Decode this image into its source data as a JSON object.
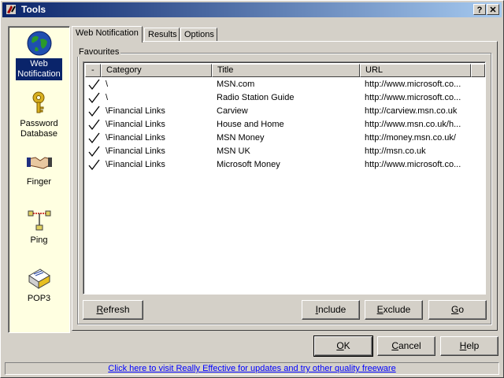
{
  "window": {
    "title": "Tools",
    "help_glyph": "?",
    "close_glyph": "✕"
  },
  "sidebar": {
    "items": [
      {
        "label_line1": "Web",
        "label_line2": "Notification",
        "icon": "globe-icon",
        "selected": true
      },
      {
        "label_line1": "Password",
        "label_line2": "Database",
        "icon": "key-icon"
      },
      {
        "label_line1": "Finger",
        "label_line2": "",
        "icon": "handshake-icon"
      },
      {
        "label_line1": "Ping",
        "label_line2": "",
        "icon": "network-icon"
      },
      {
        "label_line1": "POP3",
        "label_line2": "",
        "icon": "mail-icon"
      }
    ]
  },
  "tabs": [
    {
      "label": "Web Notification",
      "active": true
    },
    {
      "label": "Results"
    },
    {
      "label": "Options"
    }
  ],
  "favourites": {
    "group_label": "Favourites",
    "columns": [
      "-",
      "Category",
      "Title",
      "URL"
    ],
    "rows": [
      {
        "checked": true,
        "category": "\\",
        "title": "MSN.com",
        "url": "http://www.microsoft.co..."
      },
      {
        "checked": true,
        "category": "\\",
        "title": "Radio Station Guide",
        "url": "http://www.microsoft.co..."
      },
      {
        "checked": true,
        "category": "\\Financial Links",
        "title": "Carview",
        "url": "http://carview.msn.co.uk"
      },
      {
        "checked": true,
        "category": "\\Financial Links",
        "title": "House and Home",
        "url": "http://www.msn.co.uk/h..."
      },
      {
        "checked": true,
        "category": "\\Financial Links",
        "title": "MSN Money",
        "url": "http://money.msn.co.uk/"
      },
      {
        "checked": true,
        "category": "\\Financial Links",
        "title": "MSN UK",
        "url": "http://msn.co.uk"
      },
      {
        "checked": true,
        "category": "\\Financial Links",
        "title": "Microsoft Money",
        "url": "http://www.microsoft.co..."
      }
    ]
  },
  "panel_buttons": {
    "refresh_first": "R",
    "refresh_rest": "efresh",
    "include_first": "I",
    "include_rest": "nclude",
    "exclude_first": "E",
    "exclude_rest": "xclude",
    "go_first": "G",
    "go_rest": "o"
  },
  "dialog_buttons": {
    "ok_first": "O",
    "ok_rest": "K",
    "cancel_first": "C",
    "cancel_rest": "ancel",
    "help_first": "H",
    "help_rest": "elp"
  },
  "status": {
    "link_text": "Click here to visit Really Effective for updates and try other quality freeware"
  },
  "colors": {
    "titlebar": "#0a246a",
    "sidebar_bg": "#ffffe1",
    "selection": "#0a246a",
    "link": "#0000ff"
  }
}
